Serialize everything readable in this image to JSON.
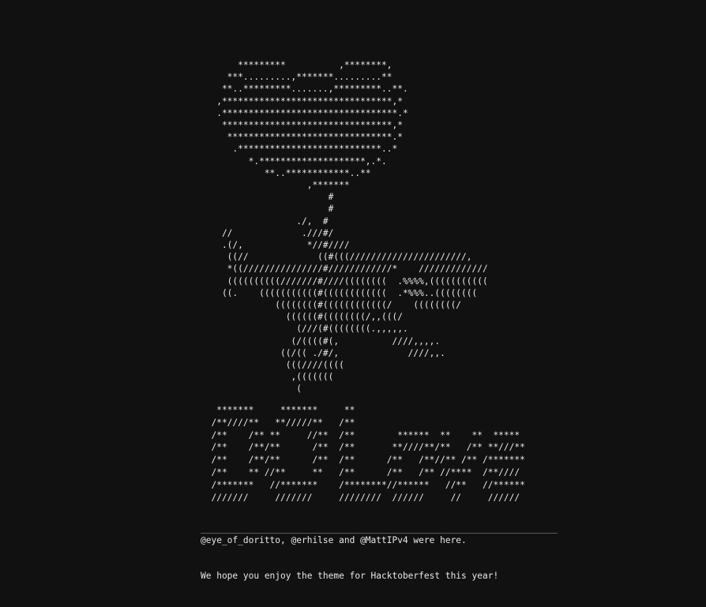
{
  "ascii_art": {
    "heart_robot": "       *********          ,********,\n     ***.........,*******.........**\n    **..*********.......,*********..**.\n   ,********************************,*\n   .*********************************.*\n    ********************************,*\n     *******************************.*\n      .***************************..*\n         *.********************,.*.\n            **..************..**\n                    ,*******\n                        #\n                        #\n                  ./,  #\n    //             .///#/\n    .(/,            *//#////\n     ((//             ((#(((//////////////////////,\n     *((///////////////#////////////*    /////////////\n     ((((((((((///////#////((((((((  .%%%%,(((((((((((\n    ((.    (((((((((((#((((((((((((  .*%%%..((((((((\n              ((((((((#((((((((((((/    ((((((((/\n                ((((((#((((((((/,,(((/\n                  (///(#((((((((.,,,,,.\n                 (/((((#(,          ////,,,,.\n               ((/(( ./#/,             ////,,.\n                (((////((((\n                 ,(((((((\n                  (",
    "logo": "   *******     *******     **\n  /**////**   **/////**   /**\n  /**    /** **     //**  /**        ******  **    **  *****\n  /**    /**/**      /**  /**       **////**/**   /** **///**\n  /**    /**/**      /**  /**      /**   /**//** /** /*******\n  /**    ** //**     **   /**      /**   /** //****  /**////\n  /*******   //*******    /********//******   //**   //******\n  ///////     ///////     ////////  //////     //     //////"
  },
  "message": {
    "line1": "@eye_of_doritto, @erhilse and @MattIPv4 were here.",
    "line2": "We hope you enjoy the theme for Hacktoberfest this year!"
  },
  "theme": {
    "background": "#111111",
    "foreground": "#e8e8e8"
  }
}
